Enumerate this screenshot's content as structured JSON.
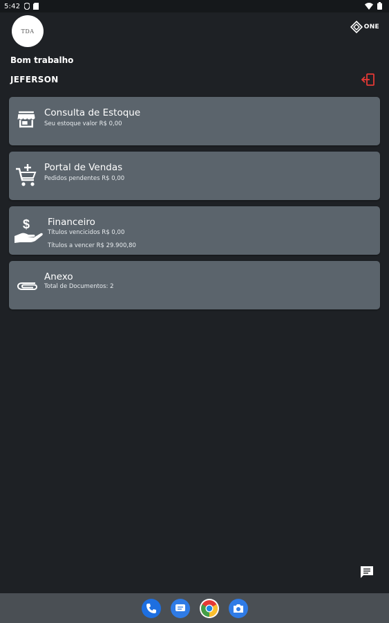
{
  "status_bar": {
    "time": "5:42"
  },
  "header": {
    "logo_text": "TDA",
    "brand_text": "ONE"
  },
  "greeting": "Bom trabalho",
  "username": "JEFERSON",
  "cards": [
    {
      "title": "Consulta de Estoque",
      "lines": [
        "Seu estoque valor R$ 0,00"
      ],
      "icon": "store-icon"
    },
    {
      "title": "Portal de Vendas",
      "lines": [
        "Pedidos  pendentes R$ 0,00"
      ],
      "icon": "cart-add-icon"
    },
    {
      "title": "Financeiro",
      "lines": [
        "Títulos vencicidos R$ 0,00",
        "Títulos a vencer R$ 29.900,80"
      ],
      "icon": "hand-money-icon"
    },
    {
      "title": "Anexo",
      "lines": [
        "Total de Documentos: 2"
      ],
      "icon": "paperclip-icon"
    }
  ],
  "dock": {
    "apps": [
      "phone-icon",
      "messages-icon",
      "chrome-icon",
      "camera-icon"
    ]
  },
  "colors": {
    "background": "#1e2125",
    "card": "#5b646c",
    "logout_accent": "#e53935",
    "navbar": "#4a4f54"
  }
}
